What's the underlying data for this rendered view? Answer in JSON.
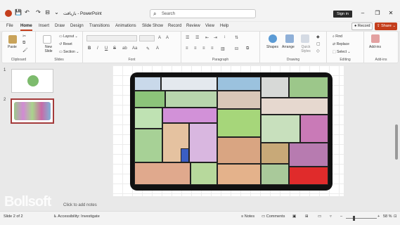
{
  "titlebar": {
    "doc_title": "بازیافت  -  PowerPoint",
    "search_placeholder": "Search",
    "signin_label": "Sign in"
  },
  "tabs": [
    "File",
    "Home",
    "Insert",
    "Draw",
    "Design",
    "Transitions",
    "Animations",
    "Slide Show",
    "Record",
    "Review",
    "View",
    "Help"
  ],
  "record_label": "Record",
  "share_label": "Share",
  "ribbon": {
    "clipboard": {
      "paste": "Paste",
      "label": "Clipboard"
    },
    "slides": {
      "new_slide": "New Slide",
      "layout": "Layout",
      "reset": "Reset",
      "section": "Section",
      "label": "Slides"
    },
    "font": {
      "label": "Font",
      "bold": "B",
      "italic": "I",
      "underline": "U",
      "strike": "S"
    },
    "paragraph": {
      "label": "Paragraph"
    },
    "drawing": {
      "shapes": "Shapes",
      "arrange": "Arrange",
      "quick_styles": "Quick Styles",
      "label": "Drawing"
    },
    "editing": {
      "find": "Find",
      "replace": "Replace",
      "select": "Select",
      "label": "Editing"
    },
    "addins": {
      "addins": "Add-ins",
      "label": "Add-ins"
    }
  },
  "slides_panel": {
    "slide1_num": "1",
    "slide2_num": "2"
  },
  "notes_placeholder": "Click to add notes",
  "watermark": "Bollsoft",
  "status": {
    "slide_info": "Slide 2 of 2",
    "accessibility": "Accessibility: Investigate",
    "notes": "Notes",
    "comments": "Comments",
    "zoom": "58 %"
  },
  "colors": {
    "accent": "#c43e1c",
    "selection": "#a33a3a"
  }
}
